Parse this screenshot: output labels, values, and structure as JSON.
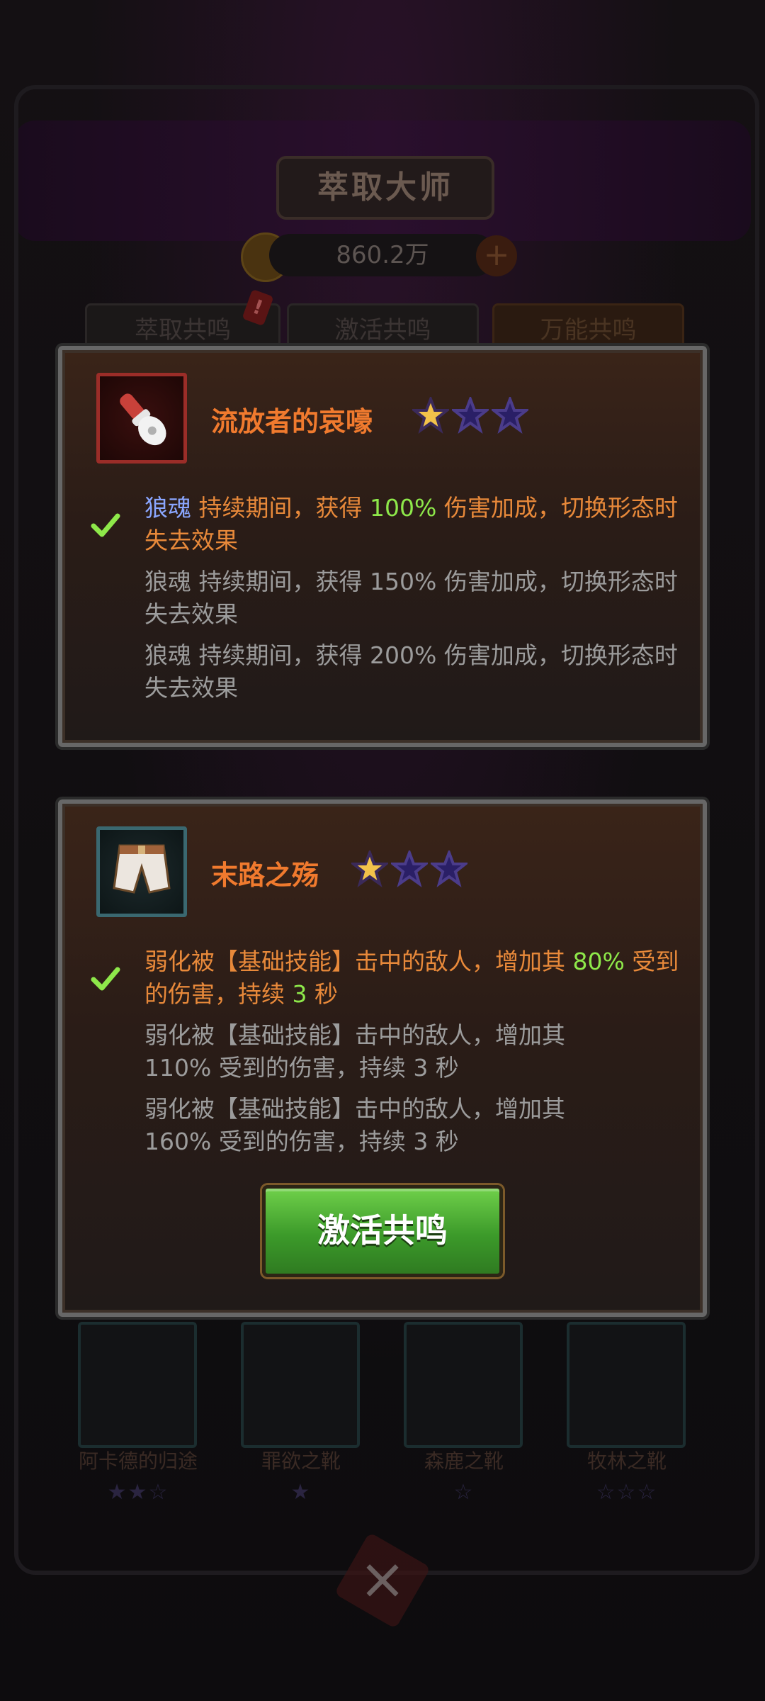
{
  "background": {
    "title": "萃取大师",
    "currency": "860.2万",
    "tabs": [
      "萃取共鸣",
      "激活共鸣",
      "万能共鸣"
    ],
    "slots": [
      {
        "name": "阿卡德的归途"
      },
      {
        "name": "罪欲之靴"
      },
      {
        "name": "森鹿之靴"
      },
      {
        "name": "牧林之靴"
      }
    ]
  },
  "cards": [
    {
      "title": "流放者的哀嚎",
      "stars_filled": 1,
      "stars_total": 3,
      "lines": [
        {
          "keyword": "狼魂",
          "pre": " 持续期间，获得 ",
          "value": "100%",
          "post": " 伤害加成，切换形态时失去效果",
          "active": true
        },
        {
          "text": "狼魂 持续期间，获得 150% 伤害加成，切换形态时失去效果",
          "active": false
        },
        {
          "text": "狼魂 持续期间，获得 200% 伤害加成，切换形态时失去效果",
          "active": false
        }
      ]
    },
    {
      "title": "末路之殇",
      "stars_filled": 1,
      "stars_total": 3,
      "lines": [
        {
          "pre": "弱化被【基础技能】击中的敌人，增加其 ",
          "value": "80%",
          "mid": " 受到的伤害，持续 ",
          "value2": "3",
          "post": " 秒",
          "active": true
        },
        {
          "text": "弱化被【基础技能】击中的敌人，增加其 110% 受到的伤害，持续 3 秒",
          "active": false
        },
        {
          "text": "弱化被【基础技能】击中的敌人，增加其 160% 受到的伤害，持续 3 秒",
          "active": false
        }
      ],
      "button_label": "激活共鸣"
    }
  ],
  "colors": {
    "title_orange": "#f07a2e",
    "active_text": "#e8893a",
    "highlight_green": "#8ee84a",
    "keyword_blue": "#8aa6ff",
    "button_green": "#4fb236"
  }
}
